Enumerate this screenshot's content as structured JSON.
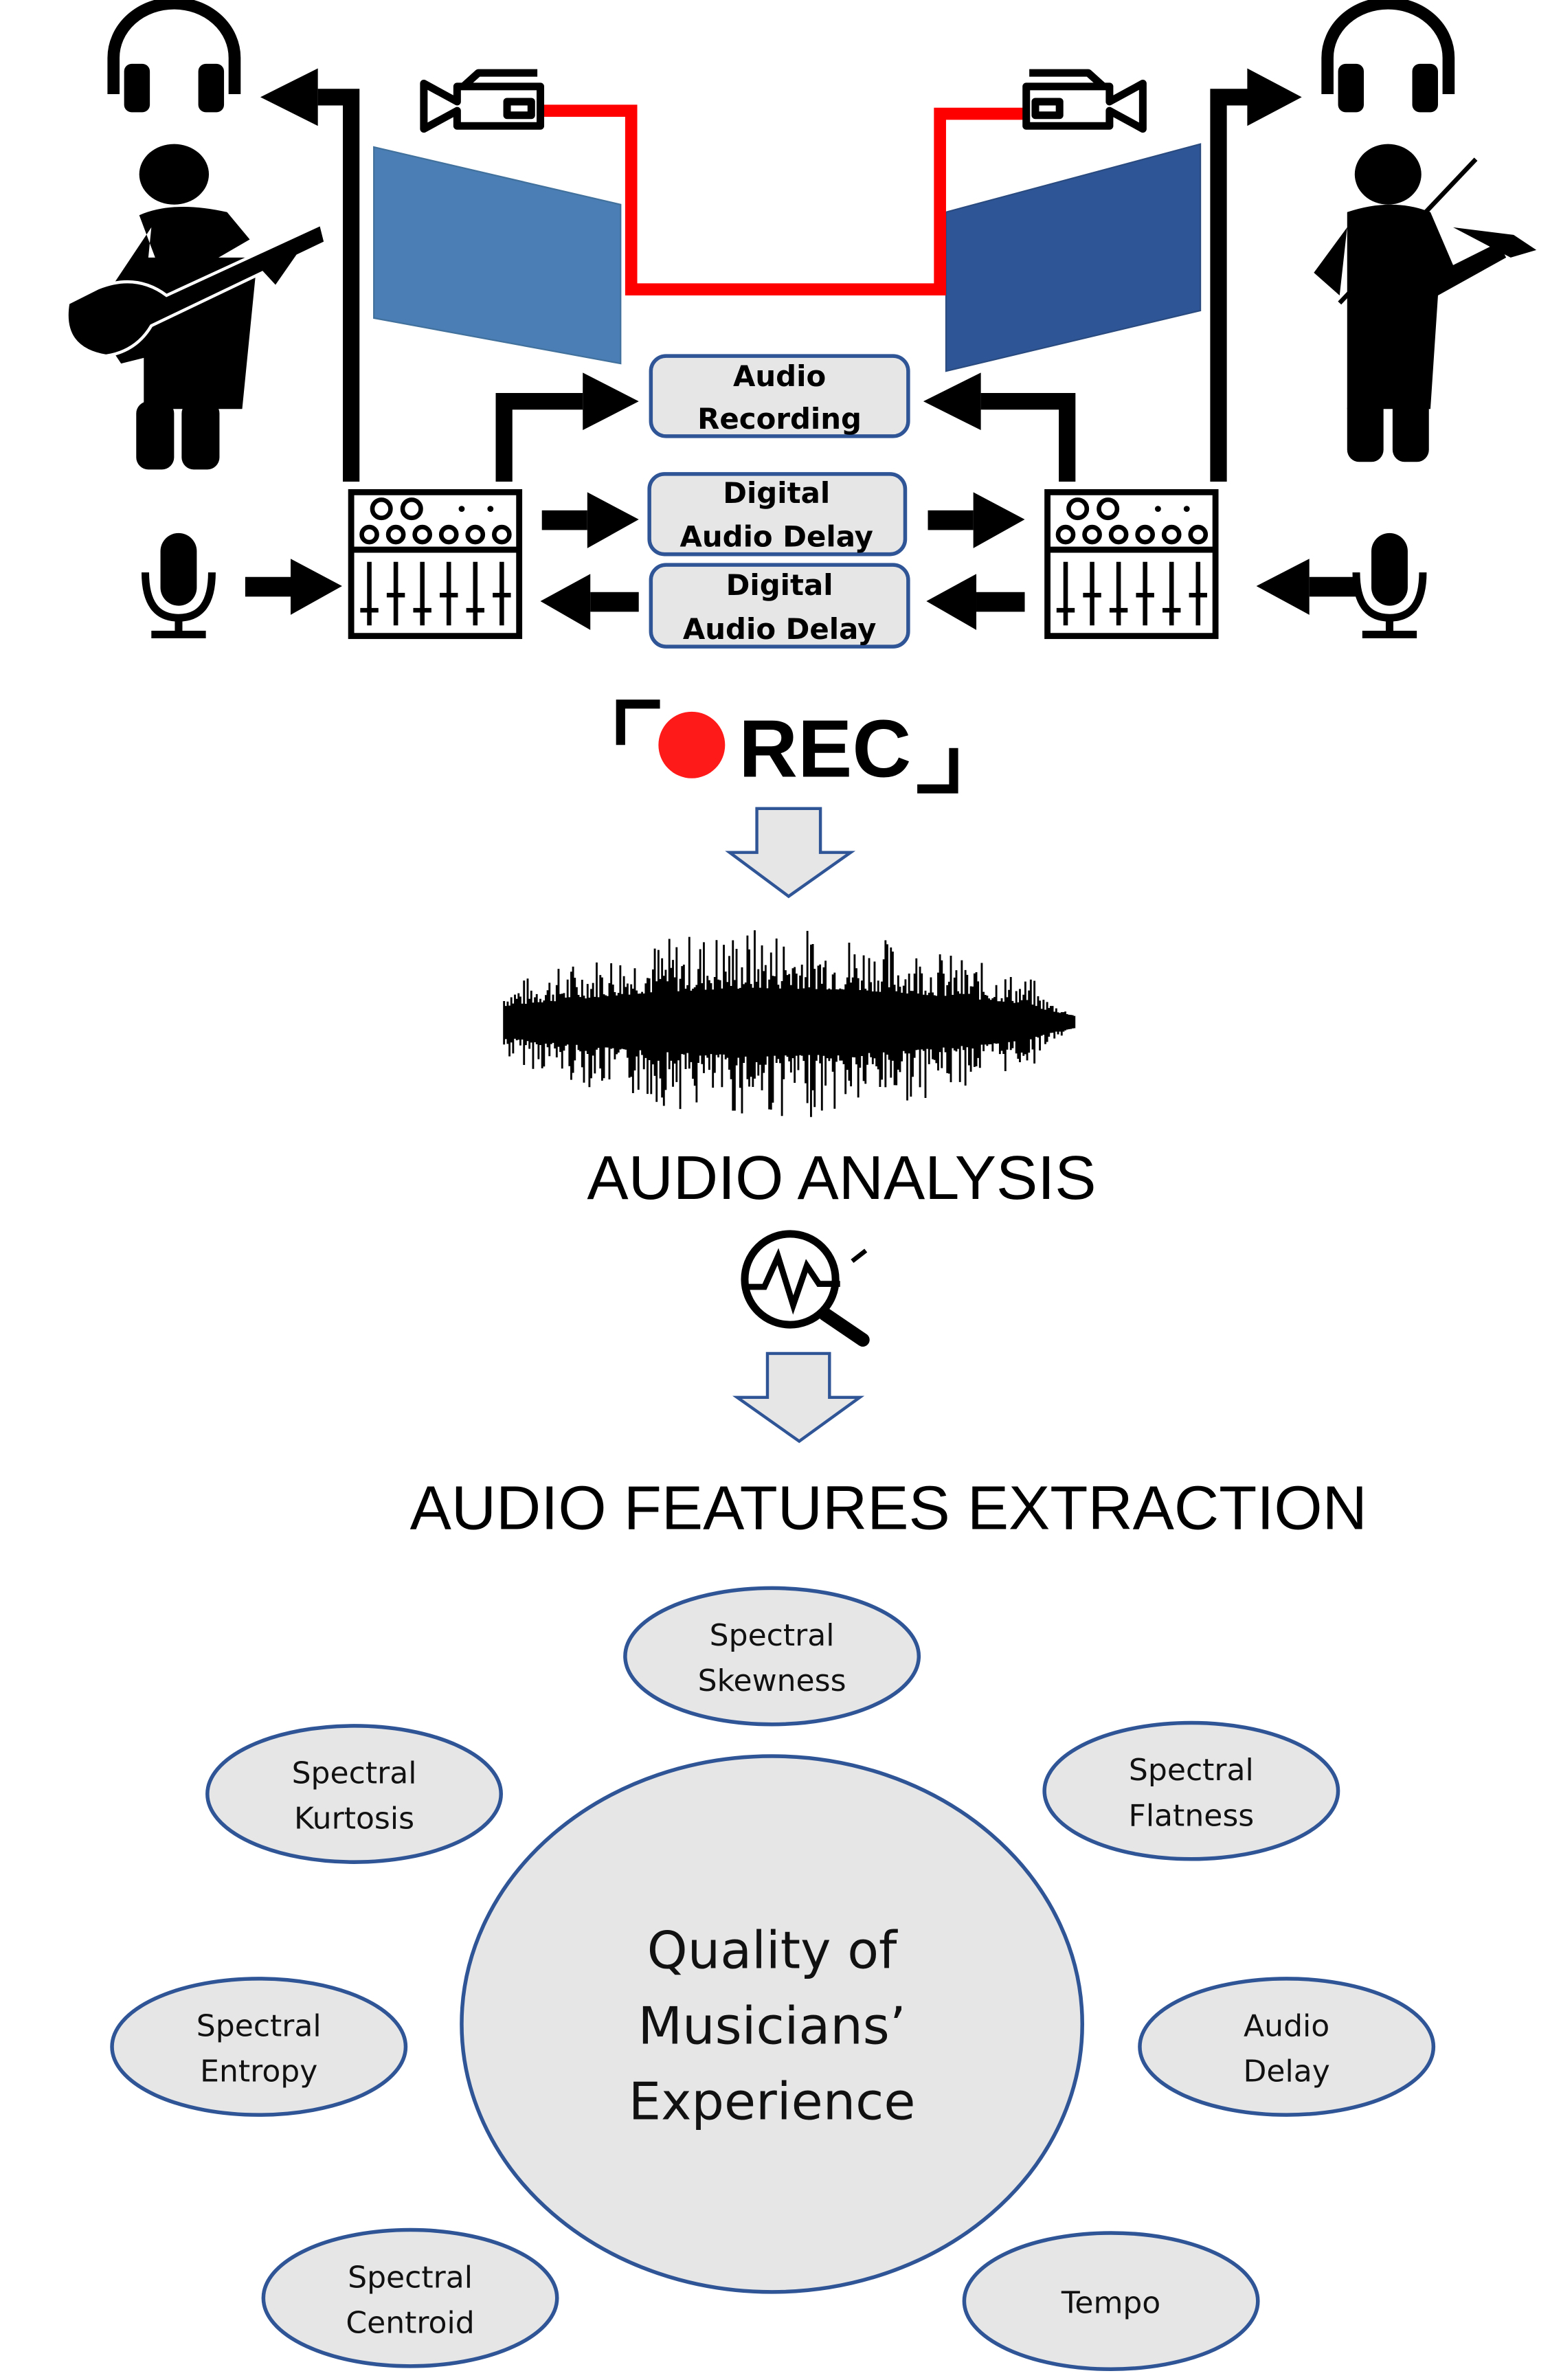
{
  "colors": {
    "screen_left": "#4a7eb4",
    "screen_right": "#2e5596",
    "video_link": "#ff0000",
    "box_fill": "#e7e6e6",
    "box_stroke": "#2f5597",
    "rec_dot": "#ff1a1a"
  },
  "setup": {
    "boxes": [
      {
        "line1": "Audio",
        "line2": "Recording"
      },
      {
        "line1": "Digital",
        "line2": "Audio Delay"
      },
      {
        "line1": "Digital",
        "line2": "Audio Delay"
      }
    ],
    "icons": [
      "headphones-icon",
      "guitarist-icon",
      "violinist-icon",
      "video-camera-icon",
      "screen-icon",
      "mixer-icon",
      "microphone-icon"
    ]
  },
  "rec": {
    "label": "REC"
  },
  "analysis": {
    "title": "AUDIO ANALYSIS",
    "icon": "analysis-magnifier-icon"
  },
  "extraction": {
    "title": "AUDIO FEATURES EXTRACTION"
  },
  "center": {
    "line1": "Quality of",
    "line2": "Musicians’",
    "line3": "Experience"
  },
  "features": [
    {
      "line1": "Spectral",
      "line2": "Skewness"
    },
    {
      "line1": "Spectral",
      "line2": "Kurtosis"
    },
    {
      "line1": "Spectral",
      "line2": "Flatness"
    },
    {
      "line1": "Spectral",
      "line2": "Entropy"
    },
    {
      "line1": "Audio",
      "line2": "Delay"
    },
    {
      "line1": "Spectral",
      "line2": "Centroid"
    },
    {
      "line1": "Tempo",
      "line2": ""
    }
  ]
}
